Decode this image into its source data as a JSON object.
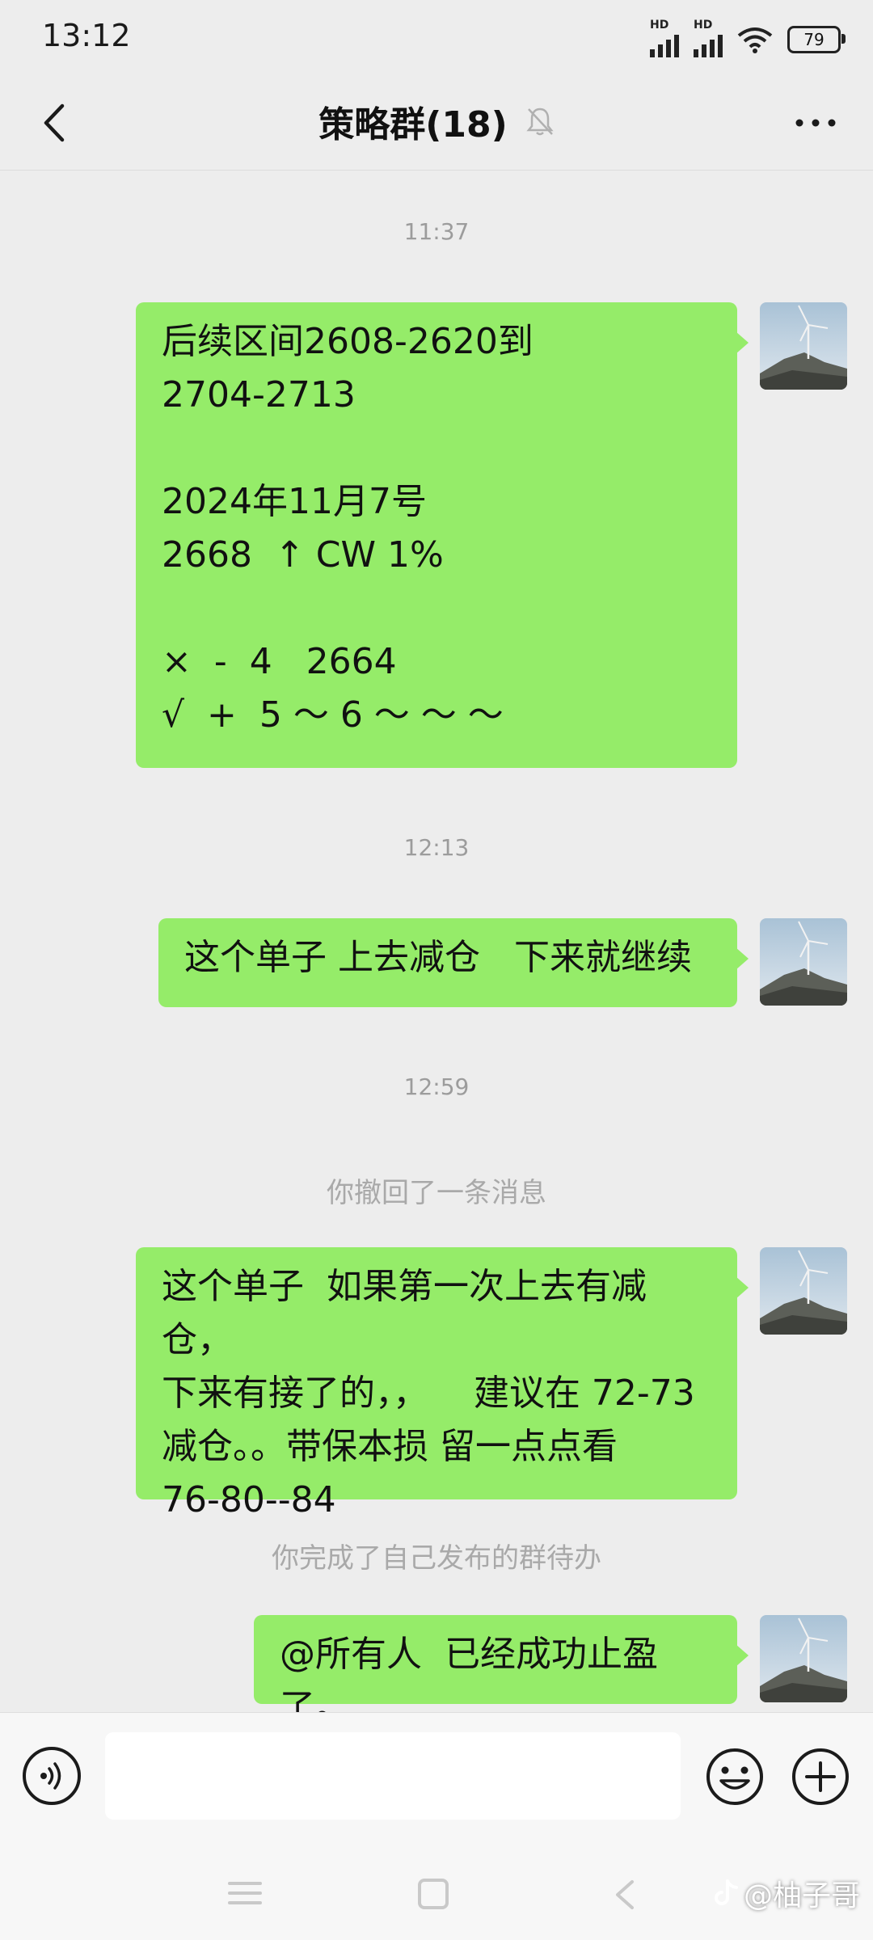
{
  "status_bar": {
    "time": "13:12",
    "signal_label_1": "HD",
    "signal_label_2": "HD",
    "battery": "79"
  },
  "header": {
    "title": "策略群(18)",
    "icons": {
      "back": "chevron-left-icon",
      "mute": "bell-off-icon",
      "more": "more-dots-icon"
    }
  },
  "chat": {
    "timestamps": [
      "11:37",
      "12:13",
      "12:59"
    ],
    "system_messages": [
      "你撤回了一条消息",
      "你完成了自己发布的群待办"
    ],
    "messages": [
      {
        "sender": "self",
        "text": "后续区间2608-2620到\n2704-2713\n\n2024年11月7号\n2668  ↑ CW 1%\n\n×  -  4   2664\n√  +  5 ～ 6 ～ ～ ～"
      },
      {
        "sender": "self",
        "text": "这个单子 上去减仓   下来就继续"
      },
      {
        "sender": "self",
        "text": "这个单子  如果第一次上去有减仓，\n下来有接了的，，    建议在 72-73\n减仓。。带保本损 留一点点看\n76-80--84"
      },
      {
        "sender": "self",
        "text": "@所有人  已经成功止盈了。"
      }
    ]
  },
  "input_bar": {
    "value": "",
    "icons": {
      "voice": "voice-icon",
      "emoji": "smiley-icon",
      "more": "plus-circle-icon"
    }
  },
  "watermark": "@柚子哥",
  "colors": {
    "bubble": "#95ec69",
    "background": "#ededed"
  }
}
